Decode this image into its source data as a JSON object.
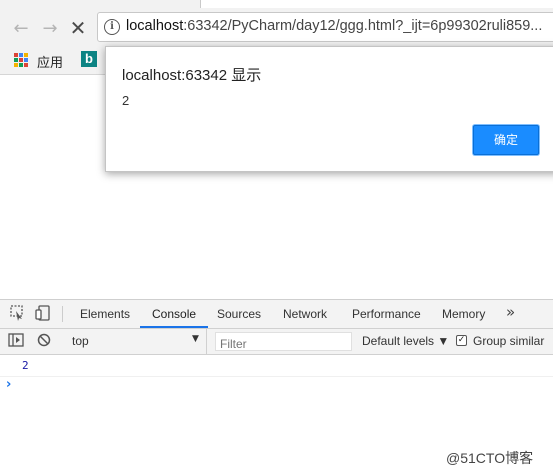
{
  "browser": {
    "address_bar": {
      "host": "localhost",
      "rest": ":63342/PyCharm/day12/ggg.html?_ijt=6p99302ruli859..."
    },
    "bookmarks": {
      "apps_label": "应用"
    }
  },
  "dialog": {
    "title": "localhost:63342 显示",
    "message": "2",
    "ok_label": "确定"
  },
  "devtools": {
    "tabs": [
      "Elements",
      "Console",
      "Sources",
      "Network",
      "Performance",
      "Memory"
    ],
    "active_tab": "Console",
    "more_symbol": "»",
    "toolbar": {
      "context": "top",
      "filter_placeholder": "Filter",
      "levels_label": "Default levels ▼",
      "group_similar_label": "Group similar",
      "group_similar_checked": true
    },
    "console_lines": [
      "2"
    ],
    "prompt_symbol": "›"
  },
  "watermark": "@51CTO博客",
  "colors": {
    "accent": "#1a8cff",
    "tab_underline": "#1a73e8",
    "console_number": "#1a1aa6",
    "bing": "#0d8484"
  }
}
